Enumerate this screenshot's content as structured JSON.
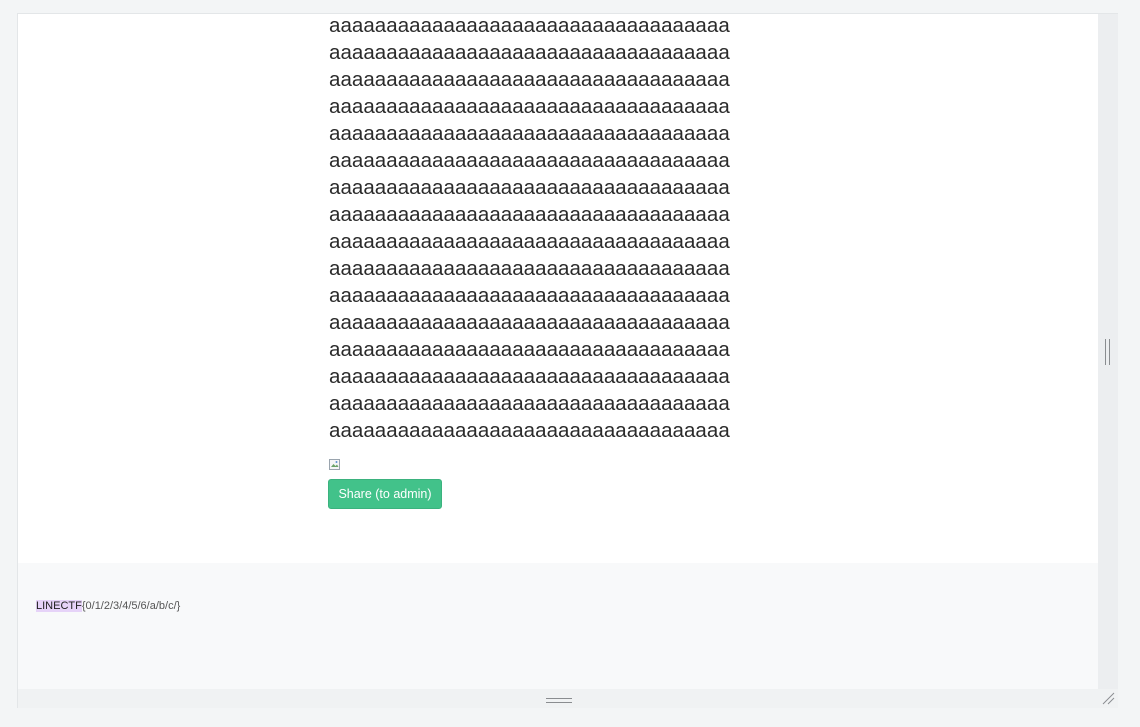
{
  "content": {
    "lines": [
      "aaaaaaaaaaaaaaaaaaaaaaaaaaaaaaaaaaa",
      "aaaaaaaaaaaaaaaaaaaaaaaaaaaaaaaaaaa",
      "aaaaaaaaaaaaaaaaaaaaaaaaaaaaaaaaaaa",
      "aaaaaaaaaaaaaaaaaaaaaaaaaaaaaaaaaaa",
      "aaaaaaaaaaaaaaaaaaaaaaaaaaaaaaaaaaa",
      "aaaaaaaaaaaaaaaaaaaaaaaaaaaaaaaaaaa",
      "aaaaaaaaaaaaaaaaaaaaaaaaaaaaaaaaaaa",
      "aaaaaaaaaaaaaaaaaaaaaaaaaaaaaaaaaaa",
      "aaaaaaaaaaaaaaaaaaaaaaaaaaaaaaaaaaa",
      "aaaaaaaaaaaaaaaaaaaaaaaaaaaaaaaaaaa",
      "aaaaaaaaaaaaaaaaaaaaaaaaaaaaaaaaaaa",
      "aaaaaaaaaaaaaaaaaaaaaaaaaaaaaaaaaaa",
      "aaaaaaaaaaaaaaaaaaaaaaaaaaaaaaaaaaa",
      "aaaaaaaaaaaaaaaaaaaaaaaaaaaaaaaaaaa",
      "aaaaaaaaaaaaaaaaaaaaaaaaaaaaaaaaaaa",
      "aaaaaaaaaaaaaaaaaaaaaaaaaaaaaaaaaaa"
    ],
    "share_button_label": "Share (to admin)",
    "broken_image_icon": "broken-image-icon"
  },
  "footer": {
    "flag_highlight": "LINECTF",
    "flag_rest": "{0/1/2/3/4/5/6/a/b/c/}"
  },
  "colors": {
    "share_button": "#42c28a",
    "flag_highlight": "#e6d3f8"
  },
  "icons": {
    "vertical_splitter": "vertical-grip-icon",
    "horizontal_splitter": "horizontal-grip-icon",
    "resize_handle": "resize-handle-icon"
  }
}
